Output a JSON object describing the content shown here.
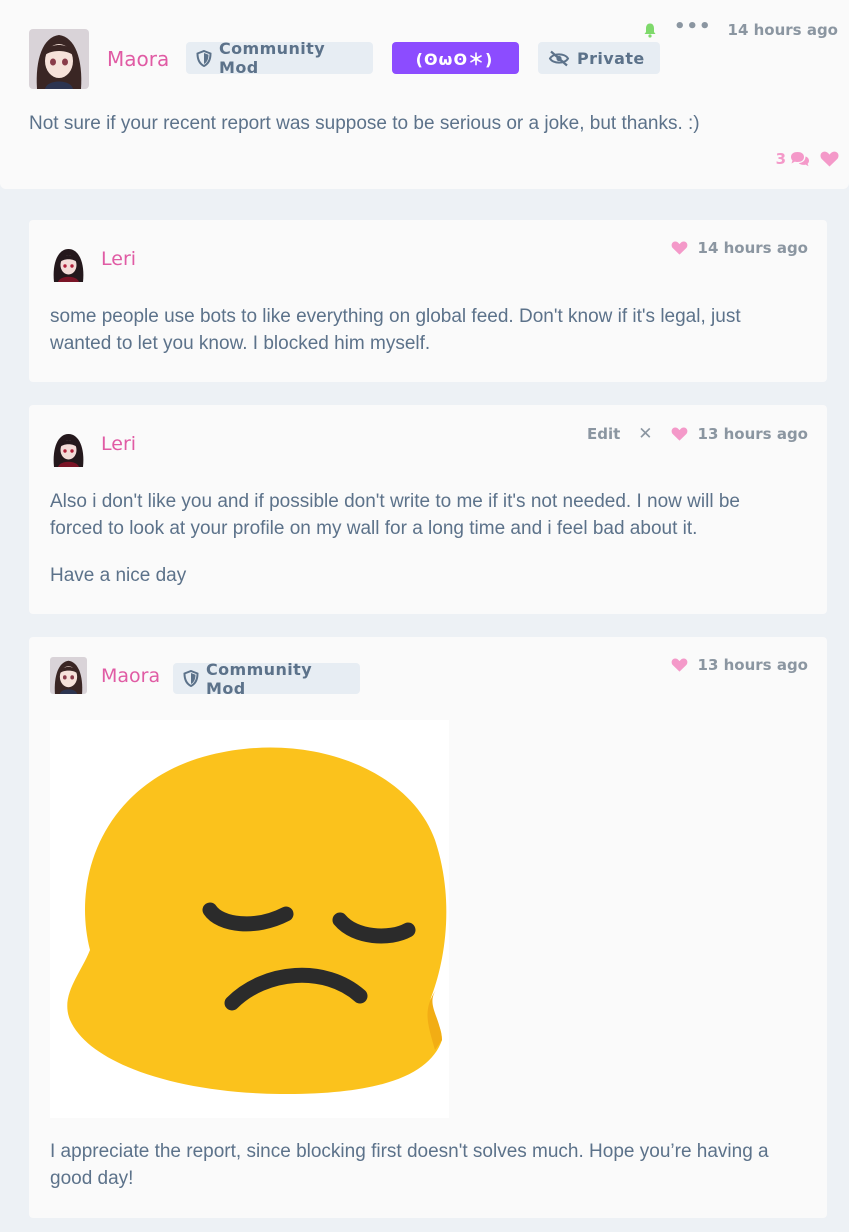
{
  "main_post": {
    "author": "Maora",
    "badges": {
      "mod": "Community Mod",
      "kaomoji": "(ʘωʘ＊)",
      "private": "Private"
    },
    "time": "14 hours ago",
    "text": "Not sure if your recent report was suppose to be serious or a joke, but thanks. :)",
    "reply_count": "3"
  },
  "replies": [
    {
      "author": "Leri",
      "time": "14 hours ago",
      "paragraphs": [
        "some people use bots to like everything on global feed. Don't know if it's legal, just wanted to let you know. I blocked him myself."
      ]
    },
    {
      "author": "Leri",
      "edit_label": "Edit",
      "delete_glyph": "✕",
      "time": "13 hours ago",
      "paragraphs": [
        "Also i don't like you and if possible don't write to me if it's not needed. I now will be forced to look at your profile on my wall for a long time and i feel bad about it.",
        "Have a nice day"
      ]
    },
    {
      "author": "Maora",
      "badge": "Community Mod",
      "time": "13 hours ago",
      "image": "pensive-face-emoji",
      "paragraphs": [
        "I appreciate the report, since blocking first doesn't solves much. Hope you’re having a good day!"
      ]
    }
  ],
  "colors": {
    "accent_pink": "#e05ba4",
    "like_pink": "#f499c9",
    "kaomoji_purple": "#8c4cff",
    "bell_green": "#7ed96b",
    "page_bg": "#edf1f5",
    "card_bg": "#fafafa",
    "text": "#5c728a"
  },
  "icons": {
    "bell": "bell-icon",
    "more": "more-dots-icon",
    "shield": "shield-icon",
    "eye_off": "eye-off-icon",
    "comments": "comments-icon",
    "heart": "heart-icon",
    "close": "close-icon"
  }
}
